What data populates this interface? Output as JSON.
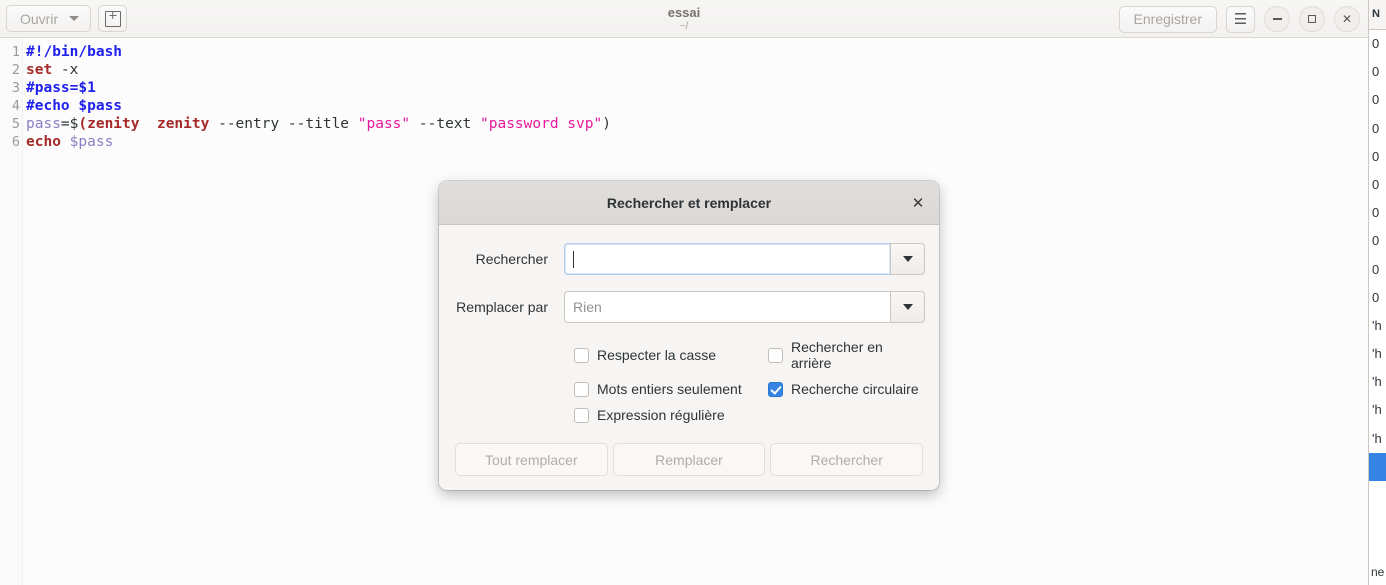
{
  "window": {
    "title": "essai",
    "subtitle": "~/",
    "toolbar": {
      "open_label": "Ouvrir",
      "new_tab_icon": "new-document-icon",
      "save_label": "Enregistrer",
      "menu_icon": "hamburger-menu-icon",
      "minimize_icon": "minimize-icon",
      "maximize_icon": "maximize-icon",
      "close_icon": "close-icon"
    }
  },
  "editor": {
    "lines": [
      {
        "number": "1",
        "tokens": [
          {
            "t": "#!/bin/bash",
            "c": "tok-comment"
          }
        ]
      },
      {
        "number": "2",
        "tokens": [
          {
            "t": "set",
            "c": "tok-kw"
          },
          {
            "t": " -x",
            "c": "tok-plain"
          }
        ]
      },
      {
        "number": "3",
        "tokens": [
          {
            "t": "#pass=$1",
            "c": "tok-comment"
          }
        ]
      },
      {
        "number": "4",
        "tokens": [
          {
            "t": "#echo $pass",
            "c": "tok-comment"
          }
        ]
      },
      {
        "number": "5",
        "tokens": [
          {
            "t": "pass",
            "c": "tok-var"
          },
          {
            "t": "=$",
            "c": "tok-punc"
          },
          {
            "t": "(zenity",
            "c": "tok-kw"
          },
          {
            "t": "  ",
            "c": "tok-plain"
          },
          {
            "t": "zenity",
            "c": "tok-kw"
          },
          {
            "t": " --entry --title ",
            "c": "tok-plain"
          },
          {
            "t": "\"pass\"",
            "c": "tok-str"
          },
          {
            "t": " --text ",
            "c": "tok-plain"
          },
          {
            "t": "\"password svp\"",
            "c": "tok-str"
          },
          {
            "t": ")",
            "c": "tok-punc"
          }
        ]
      },
      {
        "number": "6",
        "tokens": [
          {
            "t": "echo",
            "c": "tok-kw"
          },
          {
            "t": " ",
            "c": "tok-plain"
          },
          {
            "t": "$pass",
            "c": "tok-var"
          }
        ]
      }
    ]
  },
  "dialog": {
    "title": "Rechercher et remplacer",
    "close_icon": "close-icon",
    "search": {
      "label": "Rechercher",
      "value": "",
      "placeholder": "",
      "dropdown_icon": "chevron-down-icon"
    },
    "replace": {
      "label": "Remplacer par",
      "value": "",
      "placeholder": "Rien",
      "dropdown_icon": "chevron-down-icon"
    },
    "options": [
      {
        "label": "Respecter la casse",
        "checked": false
      },
      {
        "label": "Rechercher en arrière",
        "checked": false
      },
      {
        "label": "Mots entiers seulement",
        "checked": false
      },
      {
        "label": "Recherche circulaire",
        "checked": true
      },
      {
        "label": "Expression régulière",
        "checked": false
      }
    ],
    "buttons": [
      {
        "label": "Tout remplacer",
        "enabled": false
      },
      {
        "label": "Remplacer",
        "enabled": false
      },
      {
        "label": "Rechercher",
        "enabled": false
      }
    ]
  },
  "background_window": {
    "header": "N",
    "rows": [
      "0",
      "0",
      "0",
      "0",
      "0",
      "0",
      "0",
      "0",
      "0",
      "0",
      "'h",
      "'h",
      "'h",
      "'h",
      "'h"
    ],
    "selected_row": "",
    "footer": "ne"
  },
  "colors": {
    "accent": "#3584e4",
    "headerbar": "#f2f1f0",
    "dialog_header": "#dcd9d6",
    "dialog_body": "#f6f5f4",
    "editor_bg": "#fcfcfc"
  }
}
